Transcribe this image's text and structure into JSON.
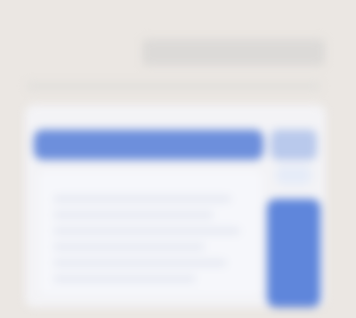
{
  "window": {
    "title": "",
    "subtitle": ""
  },
  "panel": {
    "header_label": "",
    "right_labels": [
      "",
      ""
    ],
    "rows": [
      "",
      "",
      "",
      "",
      "",
      ""
    ]
  },
  "theme": {
    "background": "#ebe7e3",
    "accent": "#6d8fdc",
    "accent_dark": "#5f86db",
    "panel_bg": "#f3f3f6"
  }
}
